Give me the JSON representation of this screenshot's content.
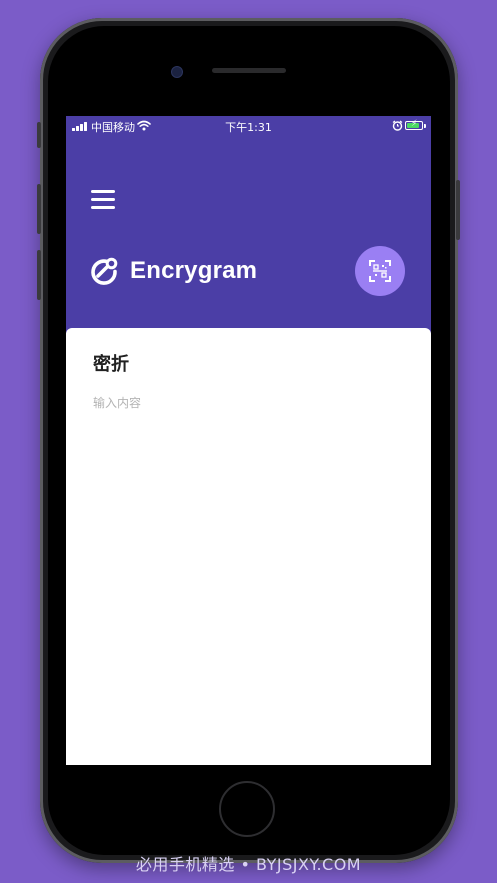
{
  "status_bar": {
    "carrier": "中国移动",
    "time": "下午1:31",
    "icons": [
      "signal-bars-icon",
      "wifi-icon",
      "alarm-clock-icon",
      "battery-charging-icon"
    ]
  },
  "header": {
    "menu_icon": "hamburger-menu-icon",
    "logo_icon": "link-logo-icon",
    "app_name": "Encrygram",
    "scan_icon": "qr-scan-icon"
  },
  "card": {
    "title": "密折",
    "input_value": "",
    "input_placeholder": "输入内容"
  },
  "watermark": "必用手机精选 • BYJSJXY.COM",
  "colors": {
    "background": "#7b5cc8",
    "header": "#4b3ea6",
    "scan_button": "#9a7ff3",
    "battery": "#4cd964"
  }
}
